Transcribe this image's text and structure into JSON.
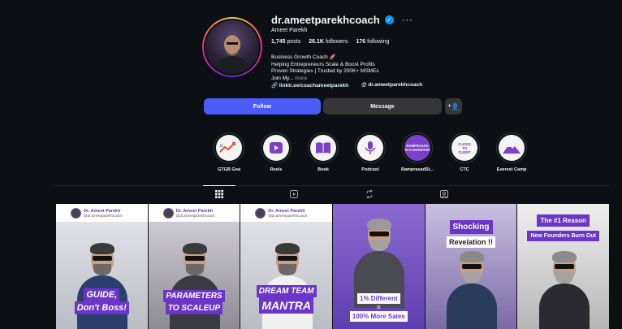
{
  "profile": {
    "username": "dr.ameetparekhcoach",
    "full_name": "Ameet Parekh",
    "stats": {
      "posts_num": "1,745",
      "posts_label": "posts",
      "followers_num": "26.1K",
      "followers_label": "followers",
      "following_num": "176",
      "following_label": "following"
    },
    "bio": [
      "Business Growth Coach 🚀",
      "Helping Entrepreneurs Scale & Boost Profits",
      "Proven Strategies | Trusted by 200K+ MSMEs",
      "Join My..."
    ],
    "more_label": "more",
    "link": "linktr.ee/coachameetparekh",
    "threads_handle": "dr.ameetparekhcoach"
  },
  "actions": {
    "follow": "Follow",
    "message": "Message"
  },
  "highlights": [
    {
      "label": "GTGB Goa",
      "icon": "gtgb-logo-icon"
    },
    {
      "label": "Reels",
      "icon": "reels-icon"
    },
    {
      "label": "Book",
      "icon": "book-icon"
    },
    {
      "label": "Podcast",
      "icon": "microphone-icon"
    },
    {
      "label": "RamprasadSt...",
      "icon": "badge-icon",
      "text": "RAMPRASAD KI KAHANIYAN"
    },
    {
      "label": "CTC",
      "icon": "text-badge-icon",
      "text": "CLICKS TO CLIENT"
    },
    {
      "label": "Everest Camp",
      "icon": "mountain-icon"
    }
  ],
  "tabs": [
    "posts-tab",
    "reels-tab",
    "reposts-tab",
    "tagged-tab"
  ],
  "posts": [
    {
      "header_name": "Dr. Ameet Parekh",
      "header_handle": "@dr.ameetparekhcoach",
      "caption1": "GUIDE,",
      "caption2": "Don't Boss!"
    },
    {
      "header_name": "Dr. Ameet Parekh",
      "header_handle": "@dr.ameetparekhcoach",
      "caption1": "PARAMETERS",
      "caption2": "TO SCALEUP"
    },
    {
      "header_name": "Dr. Ameet Parekh",
      "header_handle": "@dr.ameetparekhcoach",
      "caption1": "DREAM TEAM",
      "caption2": "MANTRA"
    },
    {
      "caption1": "1% Different",
      "caption2": "=",
      "caption3": "100% More Sales"
    },
    {
      "caption1": "Shocking",
      "caption2": "Revelation !!"
    },
    {
      "caption1": "The #1 Reason",
      "caption2": "New Founders Burn Out"
    }
  ],
  "colors": {
    "accent": "#4a5df9",
    "brand_purple": "#6b35c8",
    "background": "#0c1014"
  }
}
